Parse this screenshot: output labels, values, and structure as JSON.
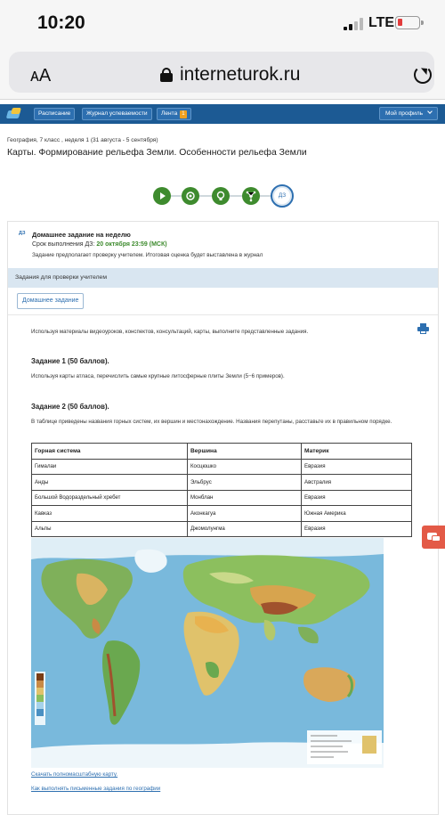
{
  "status_bar": {
    "time": "10:20",
    "network": "LTE"
  },
  "browser": {
    "text_size_button": "AA",
    "url": "interneturok.ru"
  },
  "nav": {
    "schedule": "Расписание",
    "grades": "Журнал успеваемости",
    "feed": "Лента",
    "feed_badge": "1",
    "profile": "Мой профиль"
  },
  "breadcrumb": "География, 7 класс , неделя 1 (31 августа - 5 сентября)",
  "page_title": "Карты. Формирование рельефа Земли. Особенности рельефа Земли",
  "steps": {
    "homework_label": "ДЗ"
  },
  "homework": {
    "tag": "ДЗ",
    "title": "Домашнее задание на неделю",
    "deadline_label": "Срок выполнения ДЗ:",
    "deadline_value": "20 октября 23:59 (МСК)",
    "note": "Задание предполагает проверку учителем. Итоговая оценка будет выставлена в журнал",
    "teacher_section": "Задания для проверки учителем",
    "tab": "Домашнее задание",
    "intro": "Используя материалы видеоуроков, конспектов, консультаций, карты, выполните представленные задания.",
    "task1_title": "Задание 1 (50 баллов).",
    "task1_text": "Используя карты атласа, перечислить самые крупные литосферные плиты Земли (5−6 примеров).",
    "task2_title": "Задание 2 (50 баллов).",
    "task2_text": "В таблице приведены названия горных систем, их вершин и местонахождение. Названия перепутаны, расставьте их в правильном порядке.",
    "table": {
      "headers": [
        "Горная система",
        "Вершина",
        "Материк"
      ],
      "rows": [
        [
          "Гималаи",
          "Косцюшко",
          "Евразия"
        ],
        [
          "Анды",
          "Эльбрус",
          "Австралия"
        ],
        [
          "Большой Водораздельный хребет",
          "Монблан",
          "Евразия"
        ],
        [
          "Кавказ",
          "Аконкагуа",
          "Южная Америка"
        ],
        [
          "Альпы",
          "Джомолунгма",
          "Евразия"
        ]
      ]
    },
    "link_full_map": "Скачать полномасштабную карту.",
    "link_how_to": "Как выполнять письменные задания по географии"
  },
  "colors": {
    "nav_blue": "#1c5a94",
    "accent_green": "#3e8b2e",
    "link_blue": "#2d6fb0",
    "section_bar": "#d9e6f1",
    "chat_red": "#e35a47"
  }
}
